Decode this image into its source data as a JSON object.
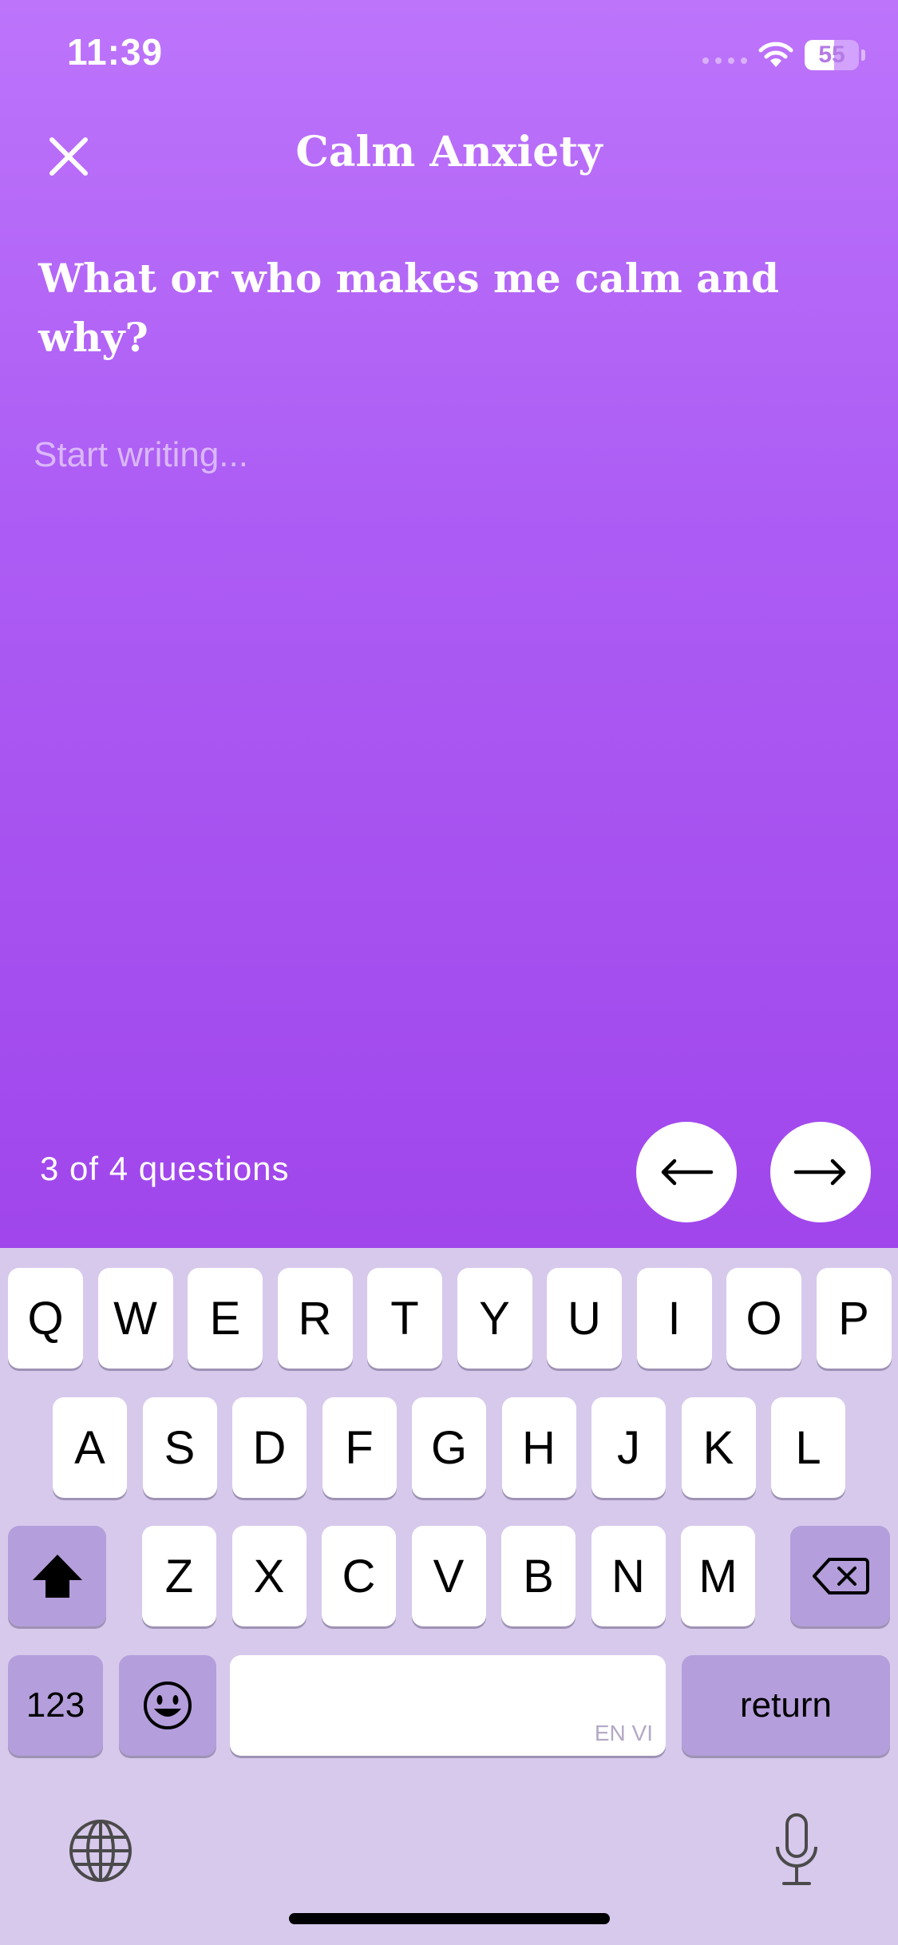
{
  "status_bar": {
    "time": "11:39",
    "battery": "55",
    "battery_level": 0.55
  },
  "header": {
    "title": "Calm Anxiety",
    "close_icon": "close-icon"
  },
  "prompt": {
    "question": "What or who makes me calm and why?"
  },
  "answer": {
    "placeholder": "Start writing...",
    "value": ""
  },
  "footer": {
    "progress": "3 of 4 questions",
    "prev_icon": "arrow-left-icon",
    "next_icon": "arrow-right-icon"
  },
  "keyboard": {
    "row1": [
      "Q",
      "W",
      "E",
      "R",
      "T",
      "Y",
      "U",
      "I",
      "O",
      "P"
    ],
    "row2": [
      "A",
      "S",
      "D",
      "F",
      "G",
      "H",
      "J",
      "K",
      "L"
    ],
    "row3": [
      "Z",
      "X",
      "C",
      "V",
      "B",
      "N",
      "M"
    ],
    "numbers_label": "123",
    "return_label": "return",
    "space_language": "EN VI"
  },
  "colors": {
    "gradient_top": "#bd74fb",
    "gradient_bottom": "#a046ec",
    "keyboard_bg": "#d7c9ec",
    "special_key": "#b49edb"
  }
}
